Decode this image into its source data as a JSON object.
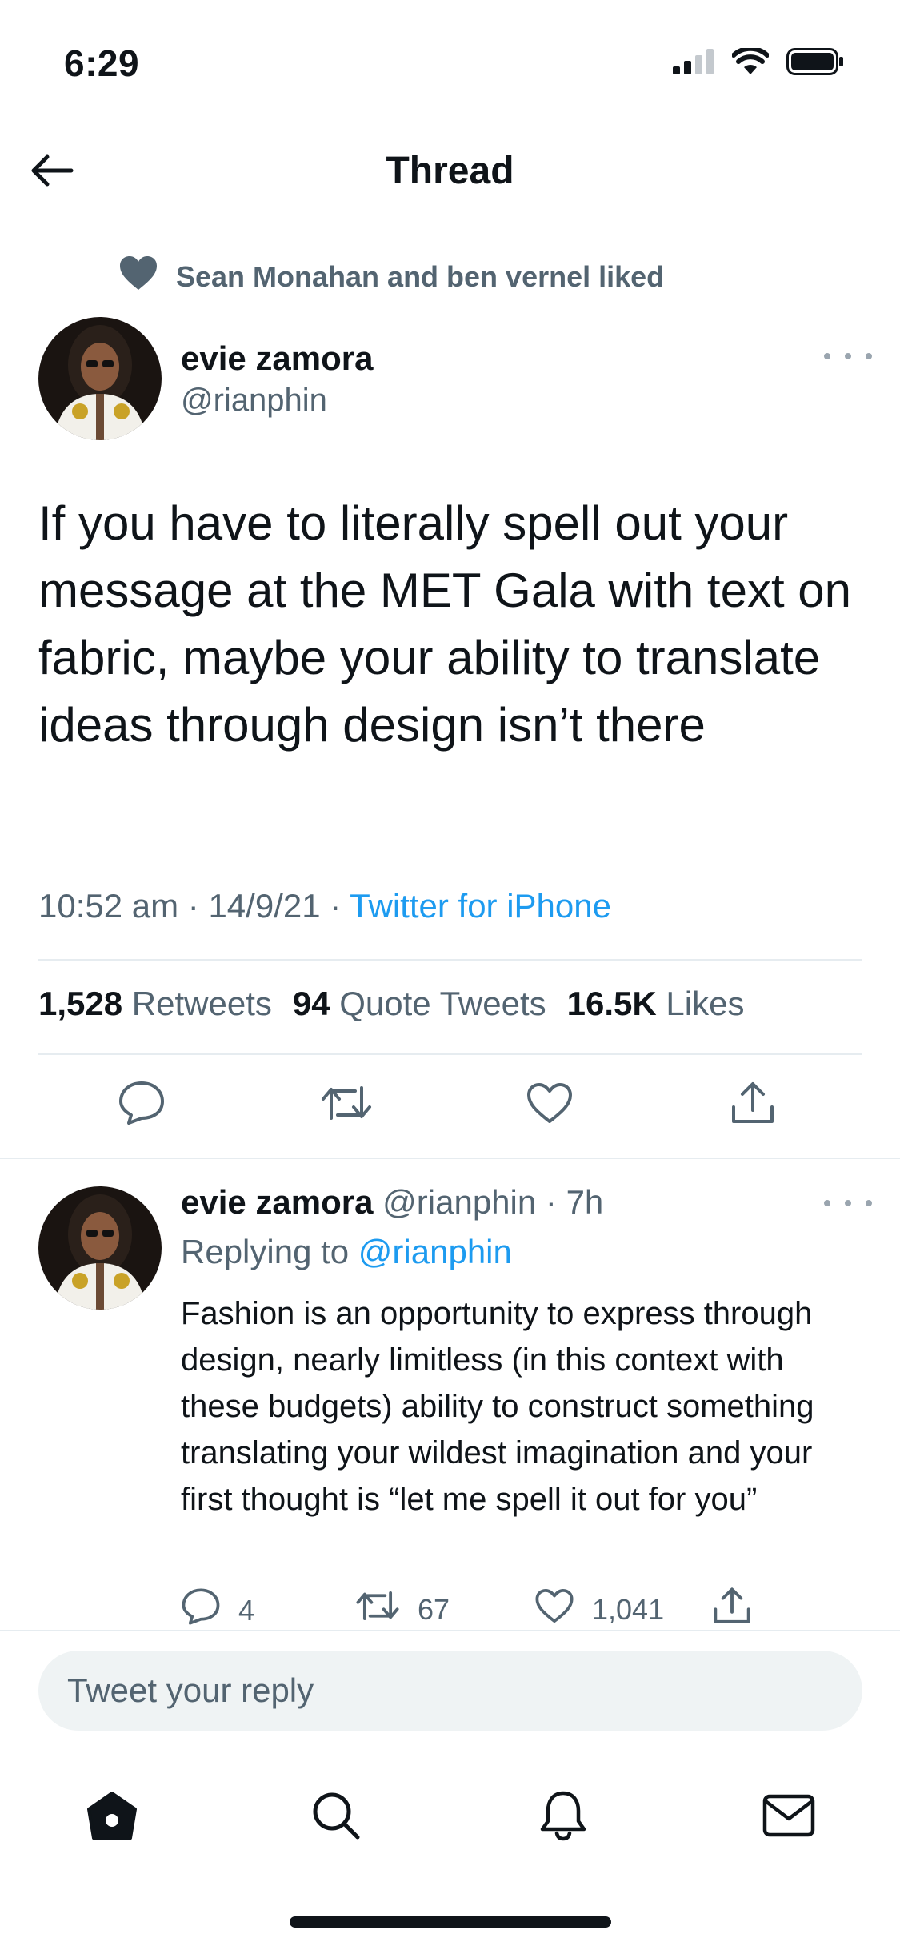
{
  "status_bar": {
    "time": "6:29"
  },
  "nav": {
    "title": "Thread"
  },
  "social_context": {
    "text": "Sean Monahan and ben vernel liked"
  },
  "tweet": {
    "author_name": "evie zamora",
    "author_handle": "@rianphin",
    "text": "If you have to literally spell out your message at the MET Gala with text on fabric, maybe your ability to translate ideas through design isn’t there",
    "time": "10:52 am",
    "date": "14/9/21",
    "source": "Twitter for iPhone",
    "retweets_count": "1,528",
    "retweets_label": "Retweets",
    "quotes_count": "94",
    "quotes_label": "Quote Tweets",
    "likes_count": "16.5K",
    "likes_label": "Likes"
  },
  "reply": {
    "author_name": "evie zamora",
    "author_handle": "@rianphin",
    "age": "7h",
    "replying_prefix": "Replying to",
    "replying_mention": "@rianphin",
    "text": "Fashion is an opportunity to express through design, nearly limitless (in this context with these budgets) ability to construct something translating your wildest imagination and your first thought is “let me spell it out for you”",
    "reply_count": "4",
    "retweet_count": "67",
    "like_count": "1,041"
  },
  "compose": {
    "placeholder": "Tweet your reply"
  },
  "icons": [
    "back-arrow-icon",
    "heart-icon",
    "more-icon",
    "reply-icon",
    "retweet-icon",
    "share-icon",
    "home-icon",
    "search-icon",
    "bell-icon",
    "mail-icon",
    "signal-icon",
    "wifi-icon",
    "battery-icon"
  ],
  "colors": {
    "accent": "#1d9bf0",
    "secondary_text": "#536471",
    "primary_text": "#0f1419",
    "divider": "#e6ecf0",
    "compose_bg": "#eff3f4"
  }
}
